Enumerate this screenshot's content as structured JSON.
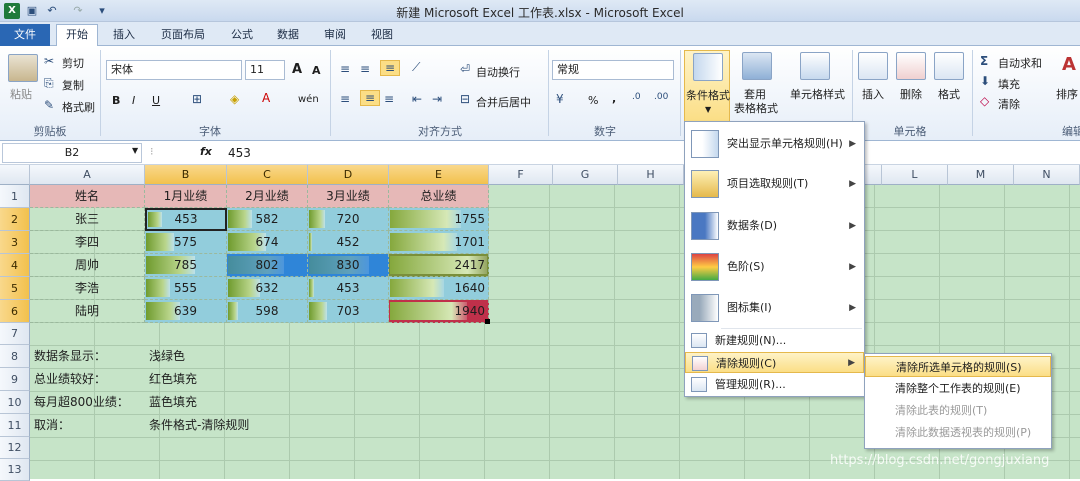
{
  "window": {
    "title": "新建 Microsoft Excel 工作表.xlsx - Microsoft Excel"
  },
  "tabs": [
    {
      "label": "文件"
    },
    {
      "label": "开始"
    },
    {
      "label": "插入"
    },
    {
      "label": "页面布局"
    },
    {
      "label": "公式"
    },
    {
      "label": "数据"
    },
    {
      "label": "审阅"
    },
    {
      "label": "视图"
    }
  ],
  "ribbon": {
    "clipboard": {
      "paste": "粘贴",
      "cut": "剪切",
      "copy": "复制",
      "format_painter": "格式刷",
      "label": "剪贴板"
    },
    "font": {
      "name": "宋体",
      "size": "11",
      "grow": "A",
      "shrink": "A",
      "bold": "B",
      "italic": "I",
      "underline": "U",
      "wen": "wén",
      "label": "字体"
    },
    "alignment": {
      "wrap": "自动换行",
      "merge": "合并后居中",
      "label": "对齐方式"
    },
    "number": {
      "format": "常规",
      "percent": "%",
      "comma": ",",
      "label": "数字"
    },
    "styles": {
      "conditional": "条件格式",
      "table_format_1": "套用",
      "table_format_2": "表格格式",
      "cell_styles": "单元格样式"
    },
    "cells": {
      "insert": "插入",
      "delete": "删除",
      "format": "格式",
      "label": "单元格"
    },
    "editing": {
      "autosum": "自动求和",
      "fill": "填充",
      "clear": "清除",
      "sort": "排序",
      "label": "编辑"
    }
  },
  "formula_bar": {
    "name_box": "B2",
    "fx": "fx",
    "value": "453"
  },
  "columns": [
    "A",
    "B",
    "C",
    "D",
    "E",
    "F",
    "G",
    "H",
    "I",
    "J",
    "K",
    "L",
    "M",
    "N"
  ],
  "rows": [
    "1",
    "2",
    "3",
    "4",
    "5",
    "6",
    "7",
    "8",
    "9",
    "10",
    "11",
    "12",
    "13"
  ],
  "table": {
    "headers": [
      "姓名",
      "1月业绩",
      "2月业绩",
      "3月业绩",
      "总业绩"
    ],
    "data": [
      [
        "张三",
        "453",
        "582",
        "720",
        "1755"
      ],
      [
        "李四",
        "575",
        "674",
        "452",
        "1701"
      ],
      [
        "周帅",
        "785",
        "802",
        "830",
        "2417"
      ],
      [
        "李浩",
        "555",
        "632",
        "453",
        "1640"
      ],
      [
        "陆明",
        "639",
        "598",
        "703",
        "1940"
      ]
    ]
  },
  "notes": [
    {
      "a": "数据条显示：",
      "b": "浅绿色"
    },
    {
      "a": "总业绩较好：",
      "b": "红色填充"
    },
    {
      "a": "每月超800业绩：",
      "b": "蓝色填充"
    },
    {
      "a": "取消：",
      "b": "条件格式-清除规则"
    }
  ],
  "cf_menu": {
    "items": [
      {
        "label": "突出显示单元格规则(H)",
        "icon": "highlight-rules-icon"
      },
      {
        "label": "项目选取规则(T)",
        "icon": "top-bottom-rules-icon"
      },
      {
        "label": "数据条(D)",
        "icon": "data-bars-icon"
      },
      {
        "label": "色阶(S)",
        "icon": "color-scales-icon"
      },
      {
        "label": "图标集(I)",
        "icon": "icon-sets-icon"
      }
    ],
    "new_rule": "新建规则(N)...",
    "clear_rules": "清除规则(C)",
    "manage_rules": "管理规则(R)..."
  },
  "clear_submenu": {
    "items": [
      {
        "label": "清除所选单元格的规则(S)",
        "enabled": true
      },
      {
        "label": "清除整个工作表的规则(E)",
        "enabled": true
      },
      {
        "label": "清除此表的规则(T)",
        "enabled": false
      },
      {
        "label": "清除此数据透视表的规则(P)",
        "enabled": false
      }
    ]
  },
  "watermark": "https://blog.csdn.net/gongjuxiang",
  "colors": {
    "header_pink": "#e6b8b7",
    "blue_fill": "#92cddc",
    "dark_blue": "#2f85d8",
    "red_fill": "#c0304a",
    "grid_green": "#c6e4c8",
    "menu_highlight": "#fbde86"
  }
}
